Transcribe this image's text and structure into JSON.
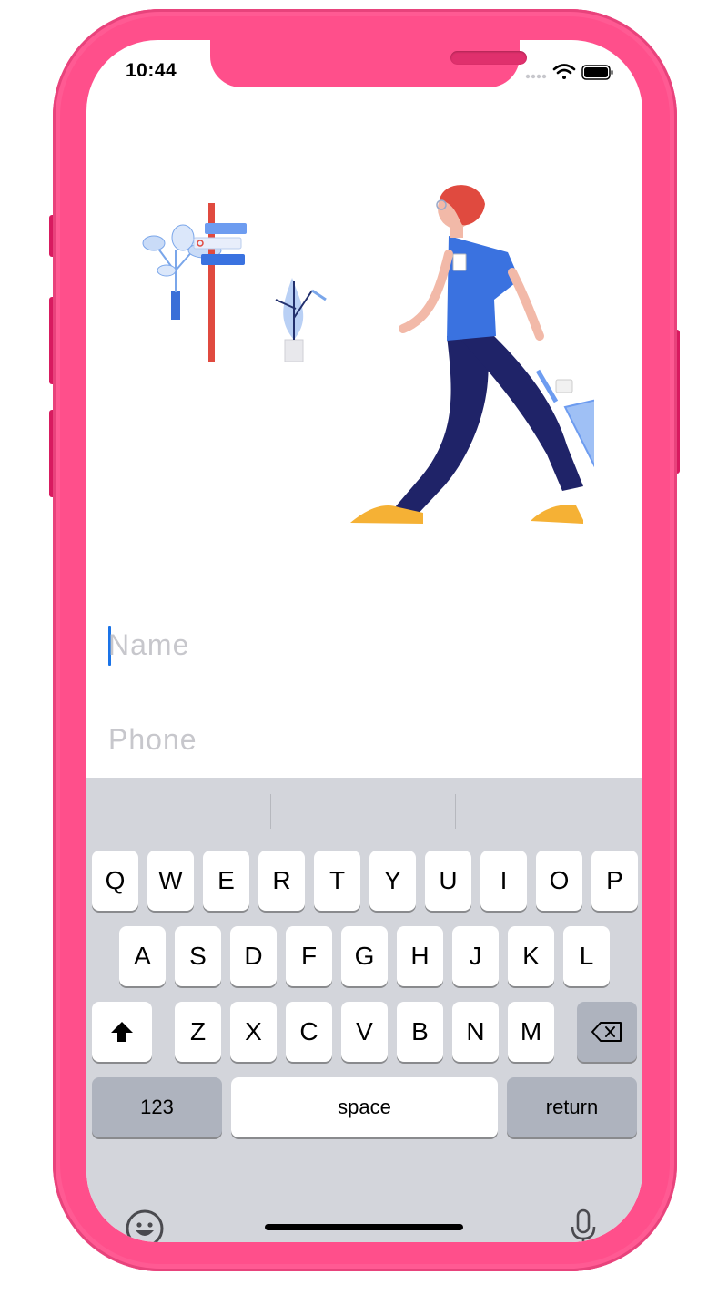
{
  "status_bar": {
    "time": "10:44"
  },
  "form": {
    "name_placeholder": "Name",
    "phone_placeholder": "Phone"
  },
  "keyboard": {
    "row1": [
      "Q",
      "W",
      "E",
      "R",
      "T",
      "Y",
      "U",
      "I",
      "O",
      "P"
    ],
    "row2": [
      "A",
      "S",
      "D",
      "F",
      "G",
      "H",
      "J",
      "K",
      "L"
    ],
    "row3": [
      "Z",
      "X",
      "C",
      "V",
      "B",
      "N",
      "M"
    ],
    "numbers_label": "123",
    "space_label": "space",
    "return_label": "return",
    "icons": {
      "shift": "shift-icon",
      "delete": "delete-icon",
      "emoji": "emoji-icon",
      "mic": "microphone-icon"
    }
  },
  "colors": {
    "phone_frame": "#ff4f8b",
    "keyboard_bg": "#d3d5db",
    "caret": "#1a73e8",
    "placeholder": "#c7c7cc"
  }
}
